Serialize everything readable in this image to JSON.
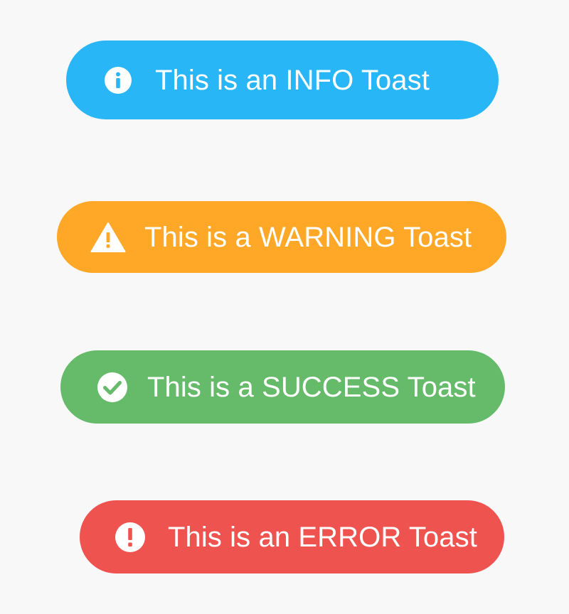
{
  "toasts": {
    "info": {
      "text": "This is an INFO Toast",
      "icon": "info-icon",
      "color": "#29b6f6"
    },
    "warning": {
      "text": "This is a WARNING Toast",
      "icon": "warning-icon",
      "color": "#ffa726"
    },
    "success": {
      "text": "This is a SUCCESS Toast",
      "icon": "check-circle-icon",
      "color": "#66bb6a"
    },
    "error": {
      "text": "This is an ERROR Toast",
      "icon": "error-icon",
      "color": "#ef5350"
    }
  }
}
